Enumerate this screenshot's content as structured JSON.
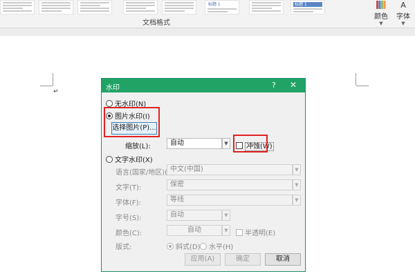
{
  "ribbon": {
    "gallery_label": "文档格式",
    "styles": [
      "标题 1",
      "标题 1"
    ],
    "colors_label": "颜色",
    "fonts_label": "字体",
    "fonts_glyph": "A"
  },
  "dialog": {
    "title": "水印",
    "help": "?",
    "close": "✕",
    "no_watermark": "无水印(N)",
    "picture_watermark": "图片水印(I)",
    "select_picture": "选择图片(P)...",
    "scale_label": "缩放(L):",
    "scale_value": "自动",
    "washout": "冲蚀(W)",
    "text_watermark": "文字水印(X)",
    "language_label": "语言(国家/地区)(L):",
    "language_value": "中文(中国)",
    "text_label": "文字(T):",
    "text_value": "保密",
    "font_label": "字体(F):",
    "font_value": "等线",
    "size_label": "字号(S):",
    "size_value": "自动",
    "color_label": "颜色(C):",
    "color_value": "自动",
    "semitransparent": "半透明(E)",
    "layout_label": "版式:",
    "diagonal": "斜式(D)",
    "horizontal": "水平(H)",
    "apply": "应用(A)",
    "ok": "确定",
    "cancel": "取消",
    "selected_option": "picture_watermark",
    "colors": {
      "titlebar": "#21a366",
      "highlight": "#e02020"
    }
  }
}
